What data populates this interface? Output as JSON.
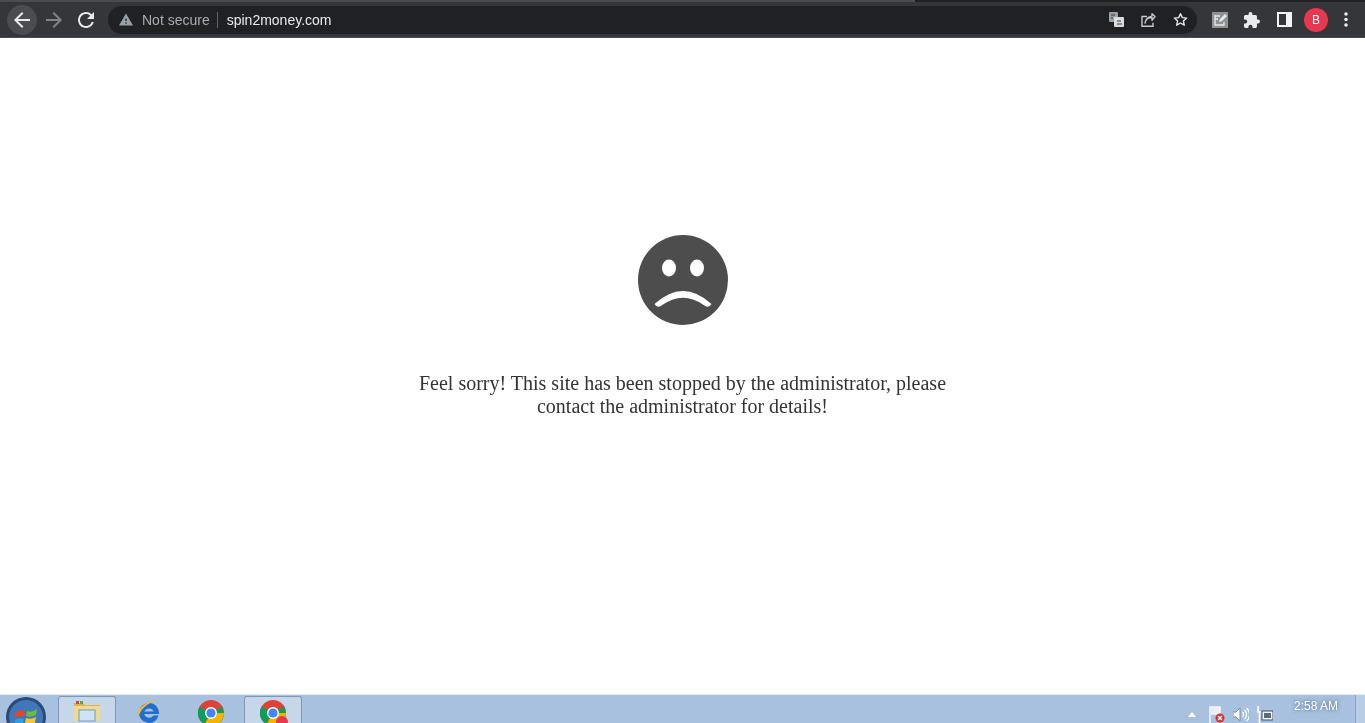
{
  "browser": {
    "nav": [
      {
        "kind": "back",
        "disabled": false,
        "hovered": true
      },
      {
        "kind": "forward",
        "disabled": true,
        "hovered": false
      },
      {
        "kind": "reload",
        "disabled": false,
        "hovered": false
      }
    ],
    "address_bar": {
      "security_label": "Not secure",
      "url": "spin2money.com"
    },
    "profile": {
      "initial": "B"
    }
  },
  "page": {
    "message": "Feel sorry! This site has been stopped by the administrator, please contact the administrator for details!"
  },
  "taskbar": {
    "apps": [
      {
        "kind": "explorer",
        "running": true
      },
      {
        "kind": "ie",
        "running": false
      },
      {
        "kind": "chrome",
        "running": false
      },
      {
        "kind": "chrome_profile",
        "running": true
      }
    ],
    "clock": "2:58 AM"
  }
}
